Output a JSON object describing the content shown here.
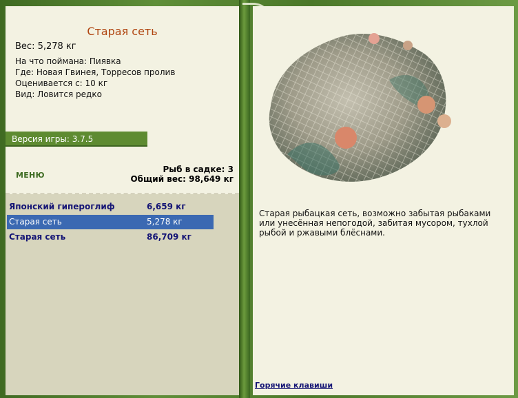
{
  "fish": {
    "title": "Старая сеть",
    "weight": "Вес: 5,278 кг",
    "caught_on": "На что поймана: Пиявка",
    "location": "Где: Новая Гвинея, Торресов пролив",
    "valued_from": "Оценивается с: 10 кг",
    "species_rarity": "Вид: Ловится редко"
  },
  "version": "Версия игры: 3.7.5",
  "menu_label": "МЕНЮ",
  "cage": {
    "count": "Рыб в садке: 3",
    "total_weight": "Общий вес: 98,649 кг"
  },
  "catch_list": [
    {
      "name": "Японский гипероглиф",
      "weight": "6,659 кг"
    },
    {
      "name": "Старая сеть",
      "weight": "5,278 кг"
    },
    {
      "name": "Старая сеть",
      "weight": "86,709 кг"
    }
  ],
  "description": "Старая рыбацкая сеть, возможно забытая рыбаками или унесённая непогодой, забитая мусором, тухлой рыбой и ржавыми блёснами.",
  "hotkeys_link": "Горячие клавиши",
  "colors": {
    "accent_green": "#5e8b31",
    "selected_blue": "#3b69b2",
    "title_orange": "#b04510"
  },
  "icons": {
    "fishing_net": "fishing-net-image",
    "corner_knot": "rope-knot-icon"
  }
}
